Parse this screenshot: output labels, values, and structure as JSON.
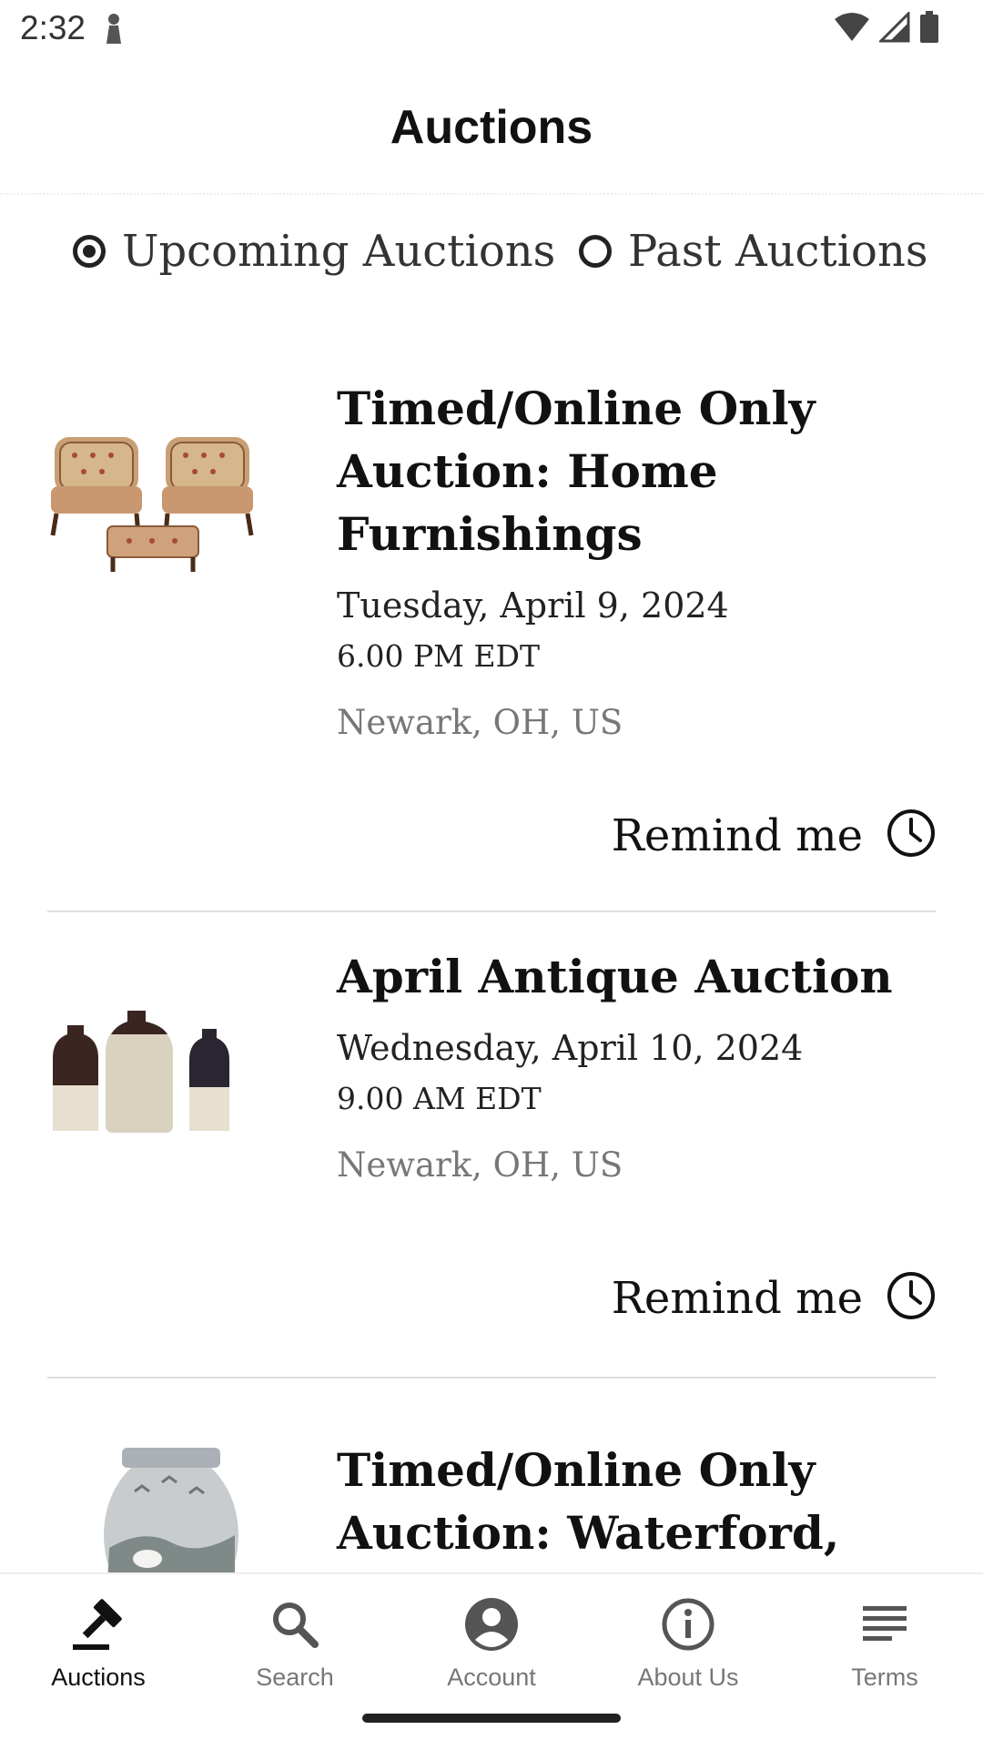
{
  "status_bar": {
    "time": "2:32"
  },
  "header": {
    "title": "Auctions"
  },
  "filter": {
    "upcoming_label": "Upcoming Auctions",
    "past_label": "Past Auctions",
    "selected": "upcoming"
  },
  "auctions": [
    {
      "title": "Timed/Online Only Auction: Home Furnishings",
      "date": "Tuesday, April 9, 2024",
      "time": "6.00 PM EDT",
      "location": "Newark, OH, US",
      "remind_label": "Remind me",
      "image": "upholstered-chairs-photo"
    },
    {
      "title": "April Antique Auction",
      "date": "Wednesday, April 10, 2024",
      "time": "9.00 AM EDT",
      "location": "Newark, OH, US",
      "remind_label": "Remind me",
      "image": "stoneware-jugs-photo"
    },
    {
      "title": "Timed/Online Only Auction: Waterford,",
      "image": "porcelain-vase-photo"
    }
  ],
  "bottom_nav": [
    {
      "label": "Auctions",
      "icon": "gavel-icon",
      "active": true
    },
    {
      "label": "Search",
      "icon": "search-icon",
      "active": false
    },
    {
      "label": "Account",
      "icon": "account-icon",
      "active": false
    },
    {
      "label": "About Us",
      "icon": "info-icon",
      "active": false
    },
    {
      "label": "Terms",
      "icon": "terms-icon",
      "active": false
    }
  ],
  "colors": {
    "text": "#111111",
    "muted": "#777777",
    "divider": "#dddddd"
  }
}
